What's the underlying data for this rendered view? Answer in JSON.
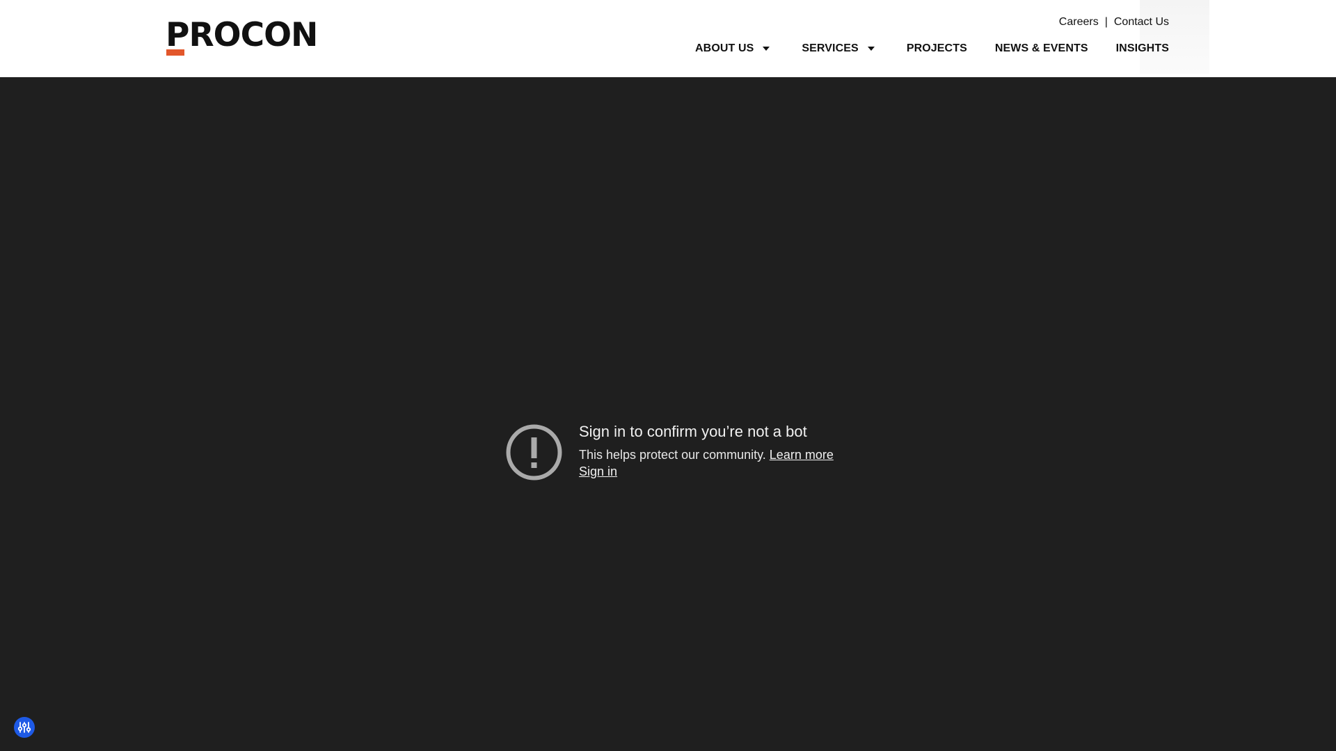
{
  "header": {
    "logo_text": "PROCON",
    "logo_accent_color": "#e2572b",
    "utility_links": {
      "careers": "Careers",
      "separator": "|",
      "contact": "Contact Us"
    },
    "nav": {
      "about": "ABOUT US",
      "services": "SERVICES",
      "projects": "PROJECTS",
      "news": "NEWS & EVENTS",
      "insights": "INSIGHTS"
    }
  },
  "notice": {
    "title": "Sign in to confirm you’re not a bot",
    "body": "This helps protect our community.",
    "learn_more": "Learn more",
    "sign_in": "Sign in",
    "icon": "exclamation-circle-icon"
  },
  "accessibility": {
    "icon": "sliders-icon",
    "color": "#1e5ae6"
  }
}
